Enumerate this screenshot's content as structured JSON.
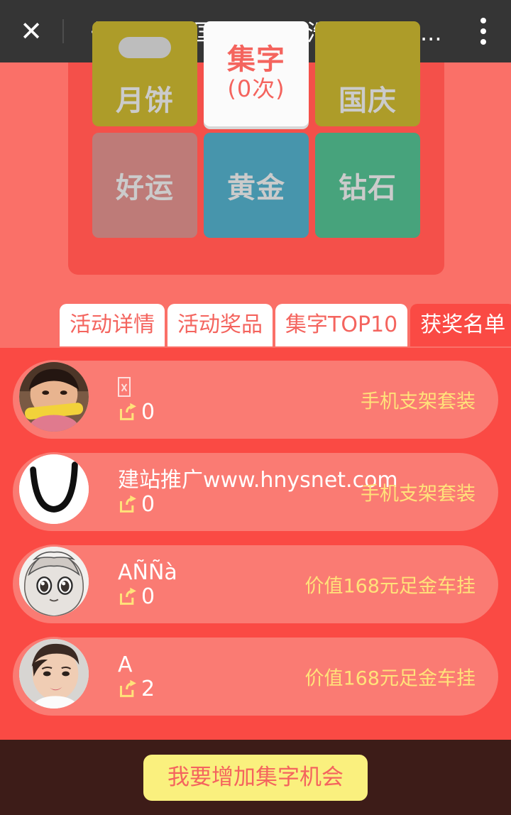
{
  "header": {
    "close_icon": "close-icon",
    "title": "《中秋遇上国庆》锡林浩特中国黄...",
    "menu_icon": "more-vertical-icon"
  },
  "theme": {
    "header_bg": "#353535",
    "page_bg": "#FA7068",
    "panel_bg": "#F4504A",
    "list_bg": "#FA4A44",
    "row_bg": "#FA7B73",
    "accent_red": "#F4645E",
    "prize_yellow": "#FFE27A",
    "cta_bg": "#FAF07E",
    "footer_bg": "#3D1C18"
  },
  "grid": {
    "tiles": [
      {
        "label": "月饼",
        "color": "#AD9C29",
        "text_color": "#CBCBCB",
        "type": "char"
      },
      {
        "label": "集字",
        "sub": "(0次)",
        "color": "#FBFBFB",
        "text_color": "#F4645E",
        "type": "center"
      },
      {
        "label": "国庆",
        "color": "#AD9C29",
        "text_color": "#CBCBCB",
        "type": "char"
      },
      {
        "label": "好运",
        "color": "#BE7B78",
        "text_color": "#CBCBCB",
        "type": "char"
      },
      {
        "label": "黄金",
        "color": "#4795AC",
        "text_color": "#CBCBCB",
        "type": "char"
      },
      {
        "label": "钻石",
        "color": "#47A37C",
        "text_color": "#CBCBCB",
        "type": "char"
      }
    ]
  },
  "tabs": [
    {
      "label": "活动详情",
      "active": false
    },
    {
      "label": "活动奖品",
      "active": false
    },
    {
      "label": "集字TOP10",
      "active": false
    },
    {
      "label": "获奖名单",
      "active": true
    }
  ],
  "winners": [
    {
      "name": "",
      "name_missing_glyph": true,
      "share_icon": "share-icon",
      "share_count": "0",
      "prize": "手机支架套装",
      "avatar": "photo-child-corn"
    },
    {
      "name": "建站推广www.hnysnet.com",
      "name_missing_glyph": false,
      "share_icon": "share-icon",
      "share_count": "0",
      "prize": "手机支架套装",
      "avatar": "sketch-u-curve"
    },
    {
      "name": "AÑÑà",
      "name_missing_glyph": false,
      "share_icon": "share-icon",
      "share_count": "0",
      "prize": "价值168元足金车挂",
      "avatar": "sketch-anime-girl"
    },
    {
      "name": "A",
      "name_missing_glyph": false,
      "share_icon": "share-icon",
      "share_count": "2",
      "prize": "价值168元足金车挂",
      "avatar": "photo-woman"
    }
  ],
  "footer": {
    "cta_label": "我要增加集字机会"
  }
}
